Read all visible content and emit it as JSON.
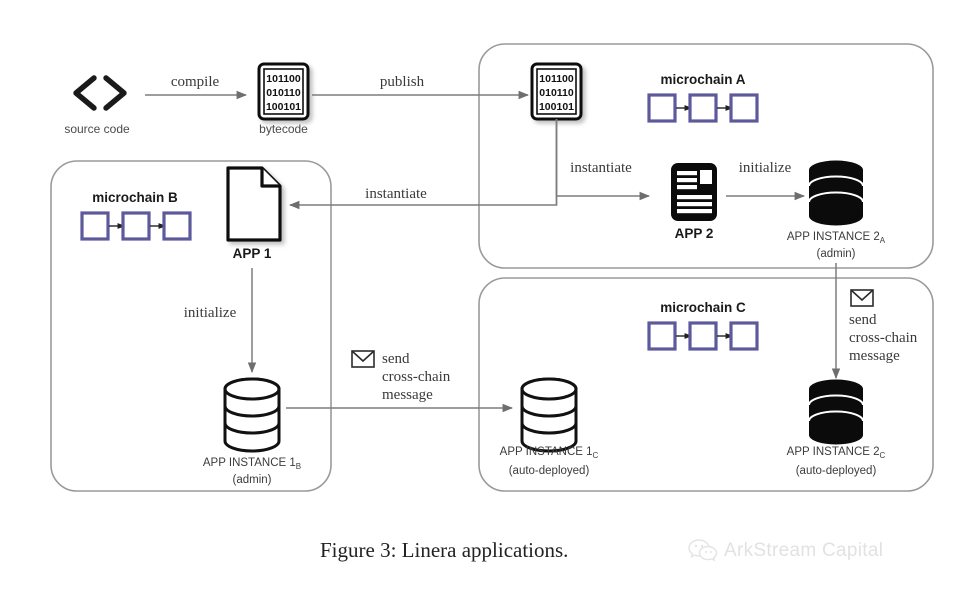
{
  "figure": {
    "caption": "Figure 3:  Linera applications.",
    "watermark": "ArkStream Capital"
  },
  "pipeline": {
    "source_code": {
      "label": "source code",
      "icon": "code-brackets-icon"
    },
    "compile_arrow": {
      "label": "compile"
    },
    "bytecode": {
      "label": "bytecode",
      "icon": "bytecode-icon",
      "lines": [
        "101100",
        "010110",
        "100101"
      ]
    },
    "publish_arrow": {
      "label": "publish"
    }
  },
  "chains": [
    {
      "id": "A",
      "title": "microchain A",
      "published_bytecode": {
        "icon": "bytecode-icon",
        "lines": [
          "101100",
          "010110",
          "100101"
        ]
      },
      "app": {
        "label": "APP 2",
        "icon": "app-document-filled-icon"
      },
      "instance": {
        "label": "APP INSTANCE 2",
        "subscript": "A",
        "note": "(admin)",
        "icon": "database-filled-icon"
      },
      "edges": [
        {
          "label": "instantiate"
        },
        {
          "label": "initialize"
        }
      ]
    },
    {
      "id": "B",
      "title": "microchain B",
      "app": {
        "label": "APP 1",
        "icon": "app-document-outline-icon"
      },
      "instance": {
        "label": "APP INSTANCE 1",
        "subscript": "B",
        "note": "(admin)",
        "icon": "database-outline-icon"
      },
      "edges": [
        {
          "label": "initialize"
        }
      ]
    },
    {
      "id": "C",
      "title": "microchain C",
      "instances": [
        {
          "label": "APP INSTANCE 1",
          "subscript": "C",
          "note": "(auto-deployed)",
          "icon": "database-outline-icon"
        },
        {
          "label": "APP INSTANCE 2",
          "subscript": "C",
          "note": "(auto-deployed)",
          "icon": "database-filled-icon"
        }
      ]
    }
  ],
  "edges": {
    "instantiate_to_b": "instantiate",
    "message_left": {
      "icon": "envelope-icon",
      "line1": "send",
      "line2": "cross-chain",
      "line3": "message"
    },
    "message_right": {
      "icon": "envelope-icon",
      "line1": "send",
      "line2": "cross-chain",
      "line3": "message"
    }
  },
  "colors": {
    "block_purple": "#5d5a9c",
    "box_stroke": "#9a9a9a",
    "line_gray": "#7d7d7d",
    "ink": "#1a1a1a"
  }
}
